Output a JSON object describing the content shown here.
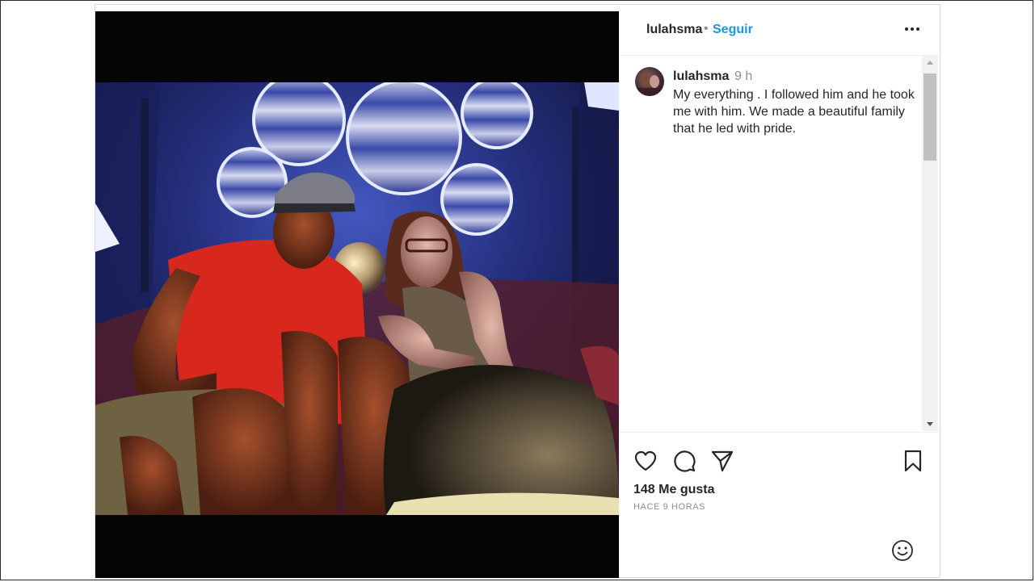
{
  "header": {
    "username": "lulahsma",
    "separator": "•",
    "follow_label": "Seguir",
    "more_icon": "more-horizontal-icon"
  },
  "caption": {
    "username": "lulahsma",
    "time": "9 h",
    "text": "My everything . I followed him and he took me with him. We made a beautiful family that he led with pride."
  },
  "actions": {
    "like_icon": "heart-icon",
    "comment_icon": "comment-icon",
    "share_icon": "send-icon",
    "save_icon": "bookmark-icon",
    "likes_text": "148 Me gusta",
    "timestamp": "HACE 9 HORAS",
    "emoji_icon": "emoji-icon"
  },
  "colors": {
    "follow_blue": "#1c96e0",
    "text_dark": "#262626",
    "text_muted": "#8e8e8e",
    "border": "#dbdbdb"
  }
}
